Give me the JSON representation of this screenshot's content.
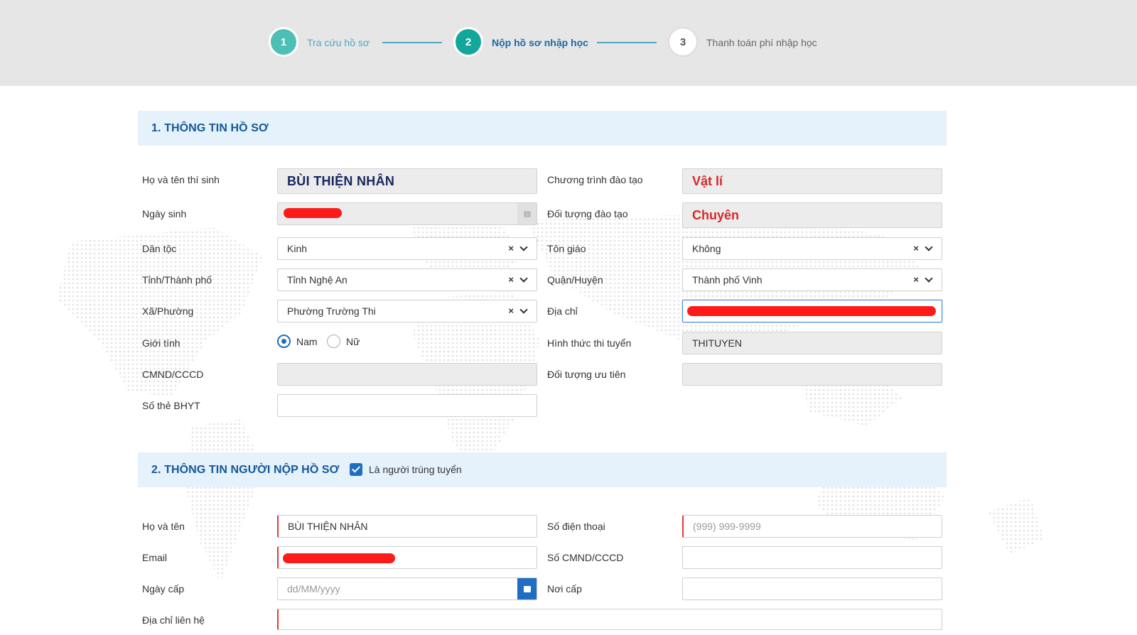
{
  "stepper": {
    "steps": [
      {
        "number": "1",
        "label": "Tra cứu hồ sơ"
      },
      {
        "number": "2",
        "label": "Nộp hồ sơ nhập học"
      },
      {
        "number": "3",
        "label": "Thanh toán phí nhập học"
      }
    ]
  },
  "section1": {
    "title": "1. THÔNG TIN HỒ SƠ",
    "left": {
      "name_label": "Họ và tên thí sinh",
      "name_value": "BÙI THIỆN NHÂN",
      "dob_label": "Ngày sinh",
      "ethnic_label": "Dân tộc",
      "ethnic_value": "Kinh",
      "province_label": "Tỉnh/Thành phố",
      "province_value": "Tỉnh Nghệ An",
      "ward_label": "Xã/Phường",
      "ward_value": "Phường Trường Thi",
      "gender_label": "Giới tính",
      "gender_male": "Nam",
      "gender_female": "Nữ",
      "id_label": "CMND/CCCD",
      "insurance_label": "Số thẻ BHYT"
    },
    "right": {
      "program_label": "Chương trình đào tạo",
      "program_value": "Vật lí",
      "target_label": "Đối tượng đào tạo",
      "target_value": "Chuyên",
      "religion_label": "Tôn giáo",
      "religion_value": "Không",
      "district_label": "Quận/Huyện",
      "district_value": "Thành phố Vinh",
      "address_label": "Địa chỉ",
      "exam_form_label": "Hình thức thi tuyển",
      "exam_form_value": "THITUYEN",
      "priority_label": "Đối tượng ưu tiên"
    }
  },
  "section2": {
    "title": "2. THÔNG TIN NGƯỜI NỘP HỒ SƠ",
    "checkbox_label": "Là người trúng tuyển",
    "left": {
      "name_label": "Họ và tên",
      "name_value": "BÙI THIỆN NHÂN",
      "email_label": "Email",
      "issue_date_label": "Ngày cấp",
      "issue_date_placeholder": "dd/MM/yyyy",
      "contact_address_label": "Địa chỉ liên hệ"
    },
    "right": {
      "phone_label": "Số điện thoại",
      "phone_placeholder": "(999) 999-9999",
      "id_label": "Số CMND/CCCD",
      "issue_place_label": "Nơi cấp"
    }
  },
  "colors": {
    "accent": "#1e6fc4",
    "step_active": "#13a79c",
    "step_done": "#4dbfb5",
    "section_bg": "#e5f1fb",
    "section_title": "#13589a",
    "required": "#e53935",
    "redaction": "#ff1a1a"
  }
}
